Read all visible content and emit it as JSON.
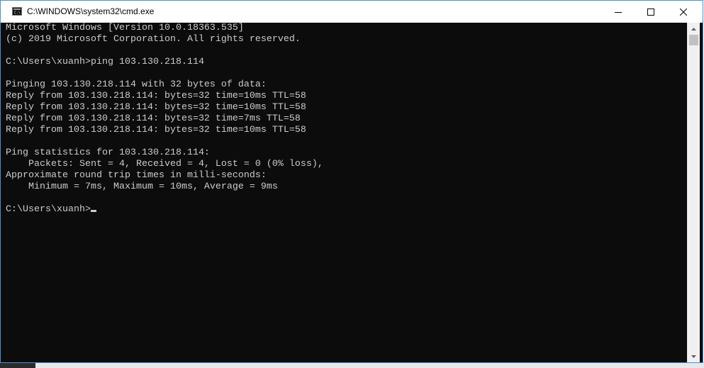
{
  "window": {
    "title": "C:\\WINDOWS\\system32\\cmd.exe",
    "minimize_label": "minimize",
    "maximize_label": "maximize",
    "close_label": "close"
  },
  "console": {
    "lines": [
      "Microsoft Windows [Version 10.0.18363.535]",
      "(c) 2019 Microsoft Corporation. All rights reserved.",
      "",
      "C:\\Users\\xuanh>ping 103.130.218.114",
      "",
      "Pinging 103.130.218.114 with 32 bytes of data:",
      "Reply from 103.130.218.114: bytes=32 time=10ms TTL=58",
      "Reply from 103.130.218.114: bytes=32 time=10ms TTL=58",
      "Reply from 103.130.218.114: bytes=32 time=7ms TTL=58",
      "Reply from 103.130.218.114: bytes=32 time=10ms TTL=58",
      "",
      "Ping statistics for 103.130.218.114:",
      "    Packets: Sent = 4, Received = 4, Lost = 0 (0% loss),",
      "Approximate round trip times in milli-seconds:",
      "    Minimum = 7ms, Maximum = 10ms, Average = 9ms",
      ""
    ],
    "prompt": "C:\\Users\\xuanh>"
  },
  "colors": {
    "console_bg": "#0c0c0c",
    "console_fg": "#cccccc",
    "titlebar_bg": "#ffffff",
    "window_border": "#4a90d9"
  },
  "icons": {
    "app": "cmd-icon",
    "minimize": "minimize-icon",
    "maximize": "maximize-icon",
    "close": "close-icon",
    "scroll_up": "scroll-up-arrow-icon",
    "scroll_down": "scroll-down-arrow-icon"
  }
}
